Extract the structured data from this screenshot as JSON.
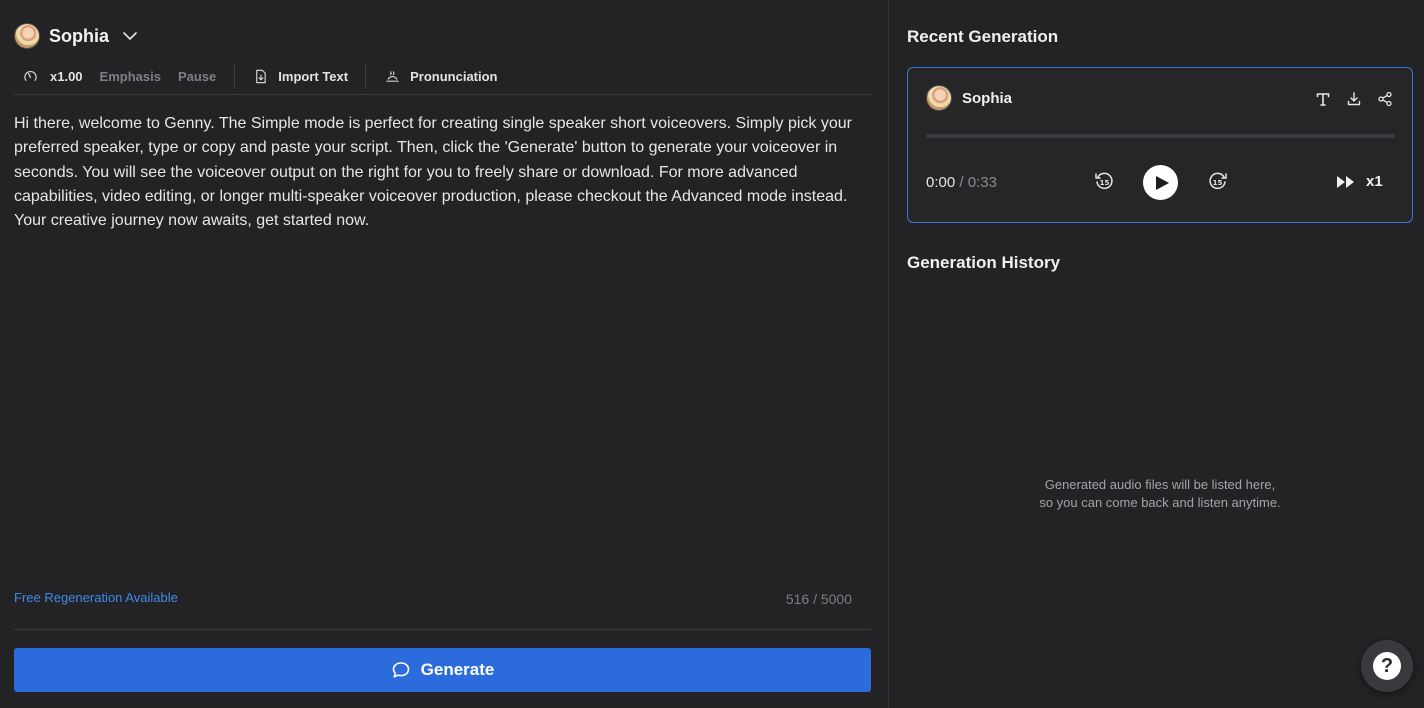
{
  "speaker": {
    "name": "Sophia"
  },
  "toolbar": {
    "speed_label": "x1.00",
    "emphasis_label": "Emphasis",
    "pause_label": "Pause",
    "import_label": "Import Text",
    "pronunciation_label": "Pronunciation"
  },
  "script": {
    "text": "Hi there, welcome to Genny. The Simple mode is perfect for creating single speaker short voiceovers. Simply pick your preferred speaker, type or copy and paste your script. Then, click the 'Generate' button to generate your voiceover in seconds. You will see the voiceover output on the right for you to freely share or download. For more advanced capabilities, video editing, or longer multi-speaker voiceover production, please checkout the Advanced mode instead. Your creative journey now awaits, get started now.",
    "free_regen": "Free Regeneration Available",
    "char_count": "516 / 5000"
  },
  "generate": {
    "label": "Generate"
  },
  "recent": {
    "title": "Recent Generation",
    "speaker_name": "Sophia",
    "current_time": "0:00",
    "separator": " / ",
    "duration": "0:33",
    "progress": 0,
    "speed": "x1",
    "icons": [
      "text-icon",
      "download-icon",
      "share-icon"
    ]
  },
  "history": {
    "title": "Generation History",
    "empty_line1": "Generated audio files will be listed here,",
    "empty_line2": "so you can come back and listen anytime."
  },
  "help": {
    "label": "?"
  },
  "colors": {
    "background": "#232326",
    "accent": "#2b6bdb",
    "link": "#3f8ae6",
    "card_border": "#3a73d6"
  }
}
